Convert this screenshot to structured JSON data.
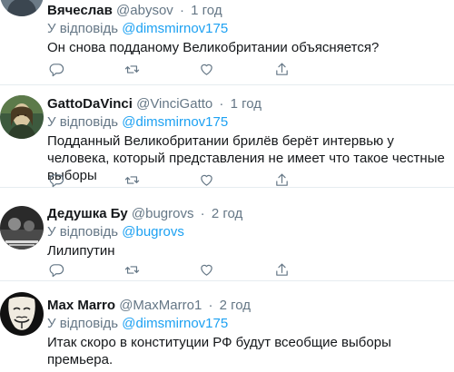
{
  "tweets": [
    {
      "name": "Вячеслав",
      "handle": "@abysov",
      "separator": "·",
      "time": "1 год",
      "reply_prefix": "У відповідь",
      "reply_to": "@dimsmirnov175",
      "text": "Он снова подданому Великобритании  объясняется?",
      "avatar": "partial-avatar-icon"
    },
    {
      "name": "GattoDaVinci",
      "handle": "@VinciGatto",
      "separator": "·",
      "time": "1 год",
      "reply_prefix": "У відповідь",
      "reply_to": "@dimsmirnov175",
      "text": "Подданный Великобритании брилёв берёт интервью у человека, который представления не имеет что такое честные выборы",
      "avatar": "painted-woman-avatar-icon"
    },
    {
      "name": "Дедушка Бу",
      "handle": "@bugrovs",
      "separator": "·",
      "time": "2 год",
      "reply_prefix": "У відповідь",
      "reply_to": "@bugrovs",
      "text": "Лилипутин",
      "avatar": "photo-avatar-icon"
    },
    {
      "name": "Max Marro",
      "handle": "@MaxMarro1",
      "separator": "·",
      "time": "2 год",
      "reply_prefix": "У відповідь",
      "reply_to": "@dimsmirnov175",
      "text": "Итак скоро в конституции РФ будут всеобщие выборы премьера.",
      "avatar": "guy-fawkes-mask-avatar-icon"
    }
  ],
  "actions": [
    "reply-icon",
    "retweet-icon",
    "like-icon",
    "share-icon"
  ],
  "colors": {
    "link": "#1da1f2",
    "muted": "#657786",
    "text": "#14171a",
    "divider": "#e6ecf0"
  }
}
